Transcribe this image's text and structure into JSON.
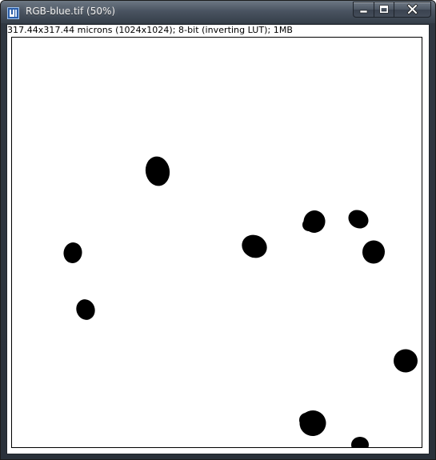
{
  "window": {
    "title": "RGB-blue.tif (50%)",
    "app_icon": "imagej-icon",
    "buttons": {
      "minimize": "minimize-icon",
      "maximize": "maximize-icon",
      "close": "close-icon"
    }
  },
  "image_info": "317.44x317.44 microns (1024x1024); 8-bit (inverting LUT); 1MB",
  "colors": {
    "titlebar": "#3d4651",
    "canvas_background": "#ffffff",
    "blob_fill": "#000000"
  }
}
